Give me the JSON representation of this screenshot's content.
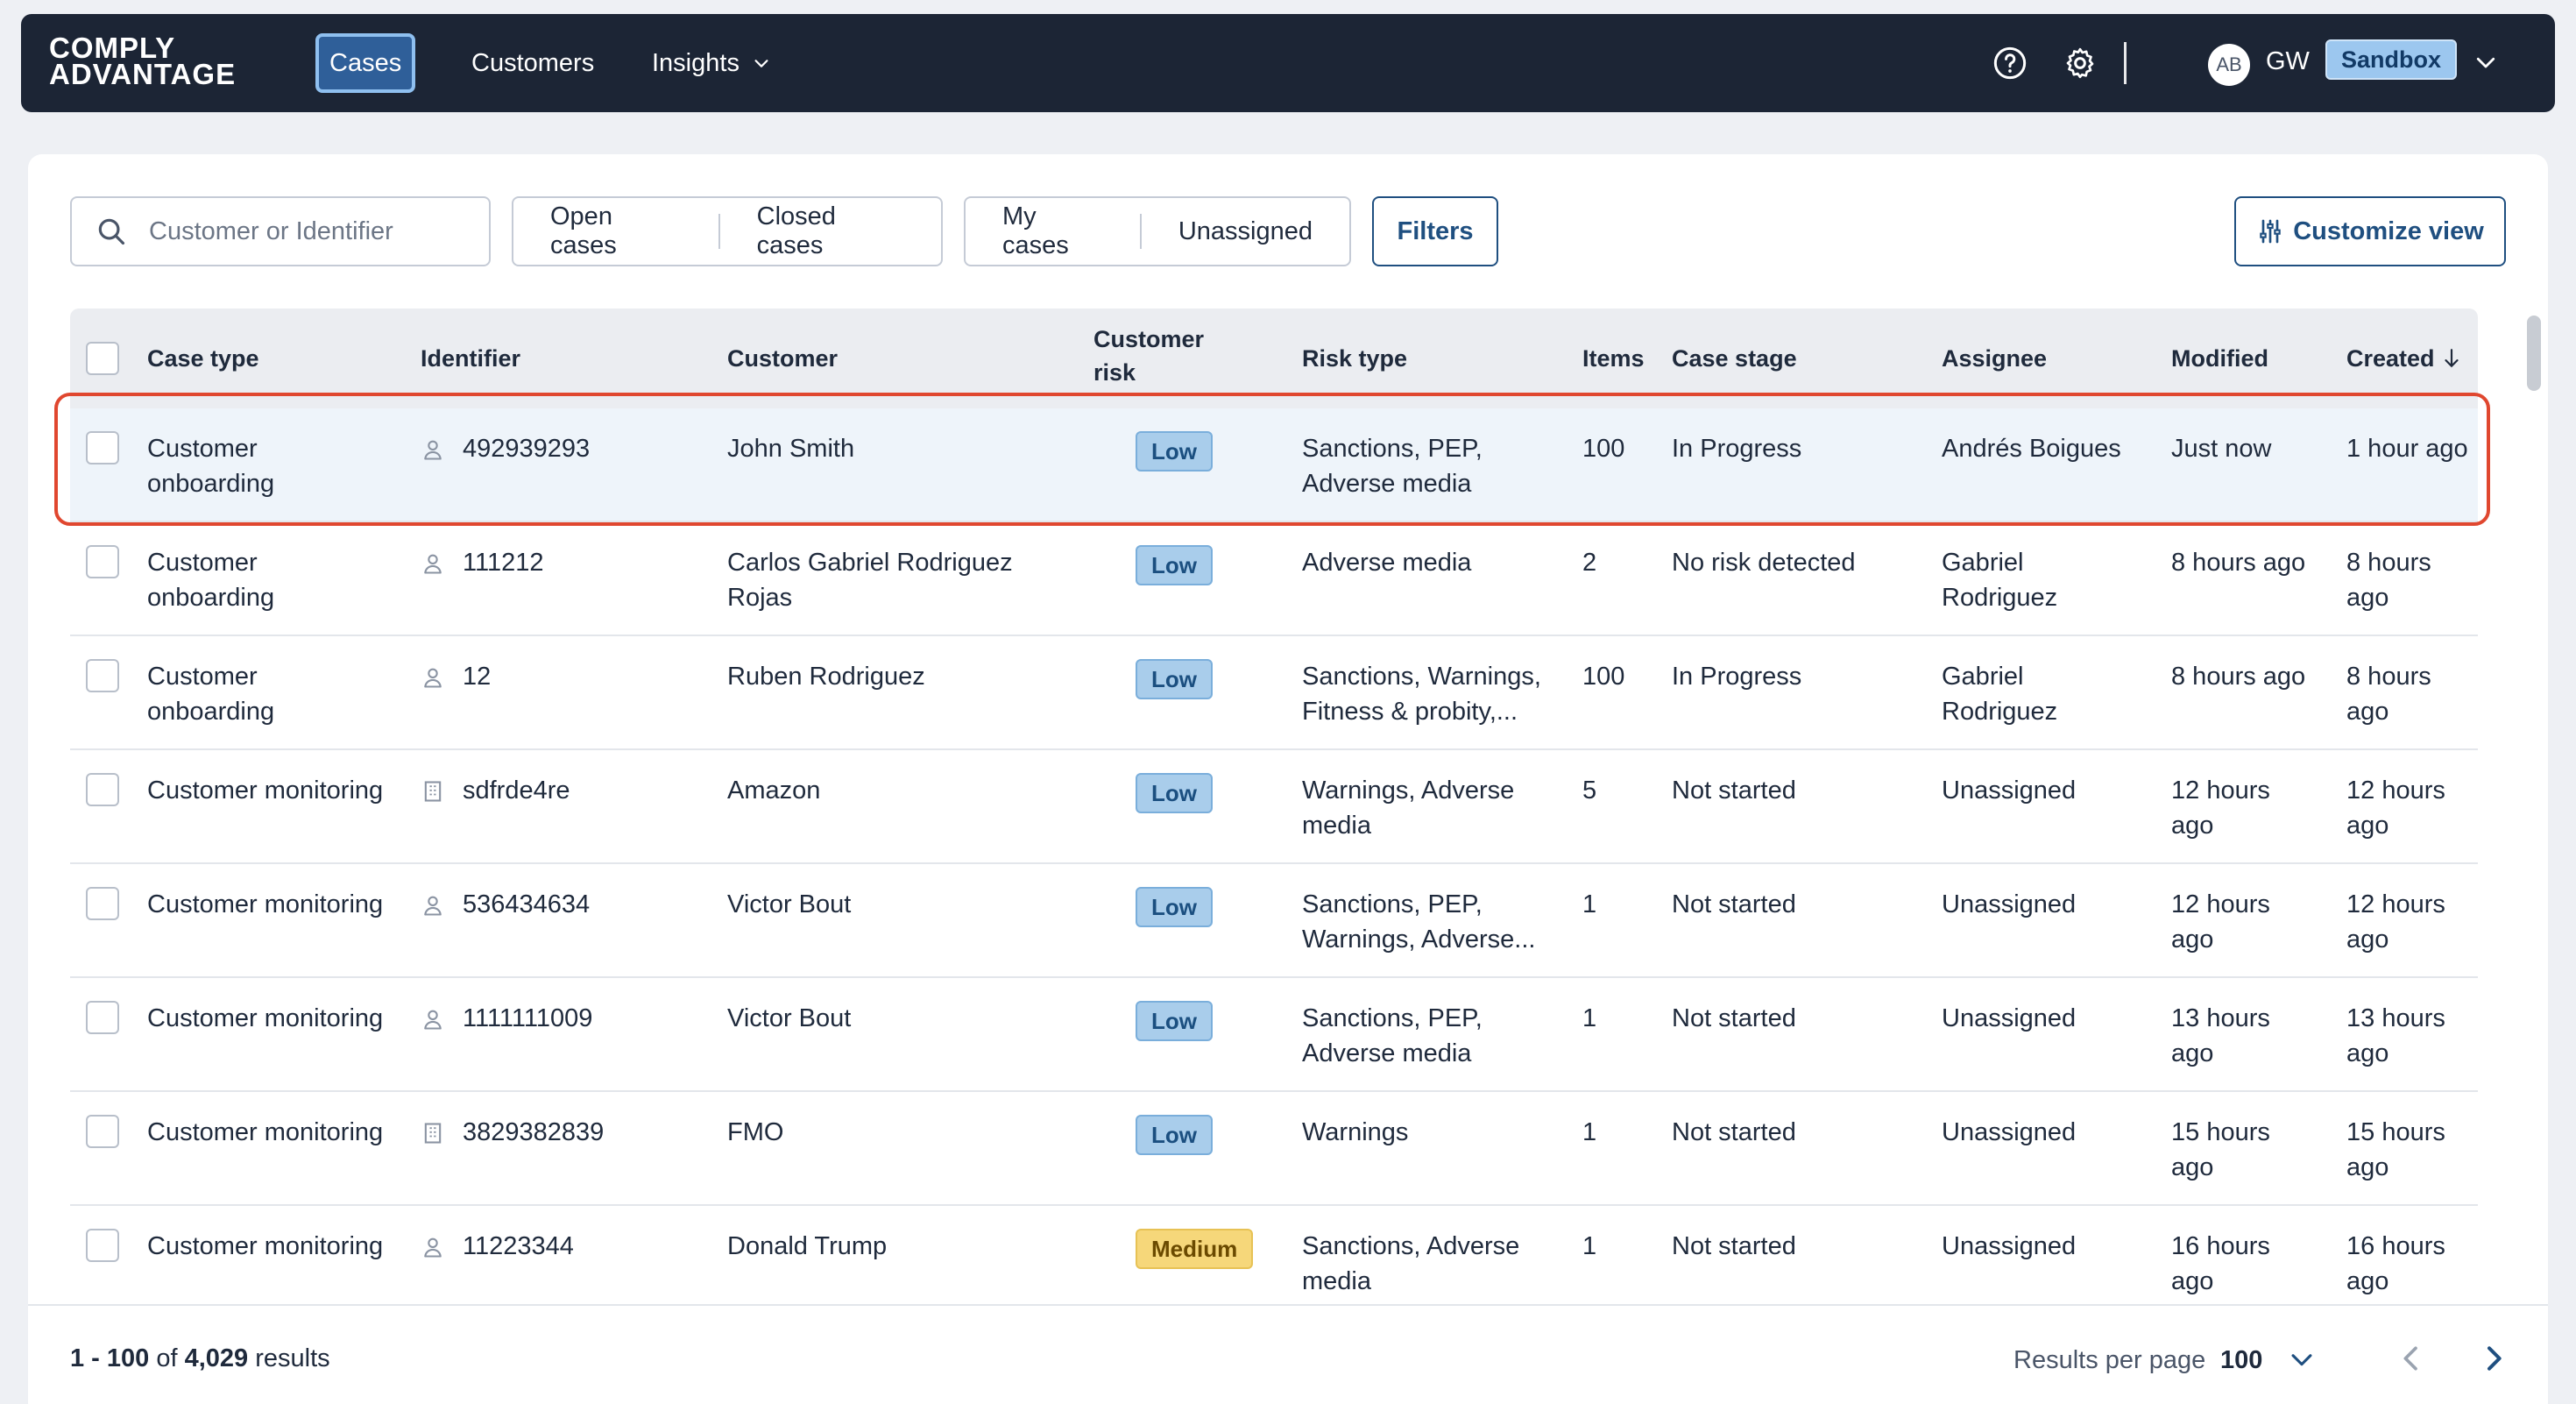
{
  "nav": {
    "logo_line1": "COMPLY",
    "logo_line2": "ADVANTAGE",
    "tabs": [
      {
        "label": "Cases"
      },
      {
        "label": "Customers"
      },
      {
        "label": "Insights"
      }
    ],
    "avatar_initials": "AB",
    "user_initials": "GW",
    "environment": "Sandbox",
    "icons": [
      "help-circle-icon",
      "gear-icon",
      "chevron-down-icon"
    ],
    "active_color": "#2f5f99",
    "bar_color": "#1c2535"
  },
  "toolbar": {
    "search_placeholder": "Customer or Identifier",
    "status_filters": [
      "Open cases",
      "Closed cases"
    ],
    "assignment_filters": [
      "My cases",
      "Unassigned"
    ],
    "filters_label": "Filters",
    "customize_label": "Customize view"
  },
  "table": {
    "columns": {
      "case_type": "Case type",
      "identifier": "Identifier",
      "customer": "Customer",
      "customer_risk_1": "Customer",
      "customer_risk_2": "risk",
      "risk_type": "Risk type",
      "items": "Items",
      "case_stage": "Case stage",
      "assignee": "Assignee",
      "modified": "Modified",
      "created": "Created",
      "created_sort": "descending"
    },
    "rows": [
      {
        "case_type": [
          "Customer",
          "onboarding"
        ],
        "id_kind": "person",
        "identifier": "492939293",
        "customer": [
          "John Smith"
        ],
        "risk": "Low",
        "risk_type": [
          "Sanctions, PEP,",
          "Adverse media"
        ],
        "items": "100",
        "stage": [
          "In Progress"
        ],
        "assignee": [
          "Andrés Boigues"
        ],
        "modified": [
          "Just now"
        ],
        "created": [
          "1 hour ago"
        ],
        "selected": true
      },
      {
        "case_type": [
          "Customer",
          "onboarding"
        ],
        "id_kind": "person",
        "identifier": "111212",
        "customer": [
          "Carlos Gabriel Rodriguez",
          "Rojas"
        ],
        "risk": "Low",
        "risk_type": [
          "Adverse media"
        ],
        "items": "2",
        "stage": [
          "No risk detected"
        ],
        "assignee": [
          "Gabriel",
          "Rodriguez"
        ],
        "modified": [
          "8 hours ago"
        ],
        "created": [
          "8 hours ago"
        ]
      },
      {
        "case_type": [
          "Customer",
          "onboarding"
        ],
        "id_kind": "person",
        "identifier": "12",
        "customer": [
          "Ruben Rodriguez"
        ],
        "risk": "Low",
        "risk_type": [
          "Sanctions, Warnings,",
          "Fitness & probity,..."
        ],
        "items": "100",
        "stage": [
          "In Progress"
        ],
        "assignee": [
          "Gabriel",
          "Rodriguez"
        ],
        "modified": [
          "8 hours ago"
        ],
        "created": [
          "8 hours ago"
        ]
      },
      {
        "case_type": [
          "Customer monitoring"
        ],
        "id_kind": "company",
        "identifier": "sdfrde4re",
        "customer": [
          "Amazon"
        ],
        "risk": "Low",
        "risk_type": [
          "Warnings, Adverse",
          "media"
        ],
        "items": "5",
        "stage": [
          "Not started"
        ],
        "assignee": [
          "Unassigned"
        ],
        "modified": [
          "12 hours",
          "ago"
        ],
        "created": [
          "12 hours",
          "ago"
        ]
      },
      {
        "case_type": [
          "Customer monitoring"
        ],
        "id_kind": "person",
        "identifier": "536434634",
        "customer": [
          "Victor Bout"
        ],
        "risk": "Low",
        "risk_type": [
          "Sanctions, PEP,",
          "Warnings, Adverse..."
        ],
        "items": "1",
        "stage": [
          "Not started"
        ],
        "assignee": [
          "Unassigned"
        ],
        "modified": [
          "12 hours",
          "ago"
        ],
        "created": [
          "12 hours",
          "ago"
        ]
      },
      {
        "case_type": [
          "Customer monitoring"
        ],
        "id_kind": "person",
        "identifier": "1111111009",
        "customer": [
          "Victor Bout"
        ],
        "risk": "Low",
        "risk_type": [
          "Sanctions, PEP,",
          "Adverse media"
        ],
        "items": "1",
        "stage": [
          "Not started"
        ],
        "assignee": [
          "Unassigned"
        ],
        "modified": [
          "13 hours",
          "ago"
        ],
        "created": [
          "13 hours",
          "ago"
        ]
      },
      {
        "case_type": [
          "Customer monitoring"
        ],
        "id_kind": "company",
        "identifier": "3829382839",
        "customer": [
          "FMO"
        ],
        "risk": "Low",
        "risk_type": [
          "Warnings"
        ],
        "items": "1",
        "stage": [
          "Not started"
        ],
        "assignee": [
          "Unassigned"
        ],
        "modified": [
          "15 hours",
          "ago"
        ],
        "created": [
          "15 hours",
          "ago"
        ]
      },
      {
        "case_type": [
          "Customer monitoring"
        ],
        "id_kind": "person",
        "identifier": "11223344",
        "customer": [
          "Donald Trump"
        ],
        "risk": "Medium",
        "risk_type": [
          "Sanctions, Adverse",
          "media"
        ],
        "items": "1",
        "stage": [
          "Not started"
        ],
        "assignee": [
          "Unassigned"
        ],
        "modified": [
          "16 hours",
          "ago"
        ],
        "created": [
          "16 hours",
          "ago"
        ]
      }
    ]
  },
  "footer": {
    "range": "1 - 100",
    "of": "of",
    "total": "4,029",
    "results_word": "results",
    "rpp_label": "Results per page",
    "rpp_value": "100"
  },
  "colors": {
    "accent": "#1f4f80",
    "risk_low": "#a9cdeb",
    "risk_medium": "#f6d77a",
    "highlight": "#e0472f"
  }
}
